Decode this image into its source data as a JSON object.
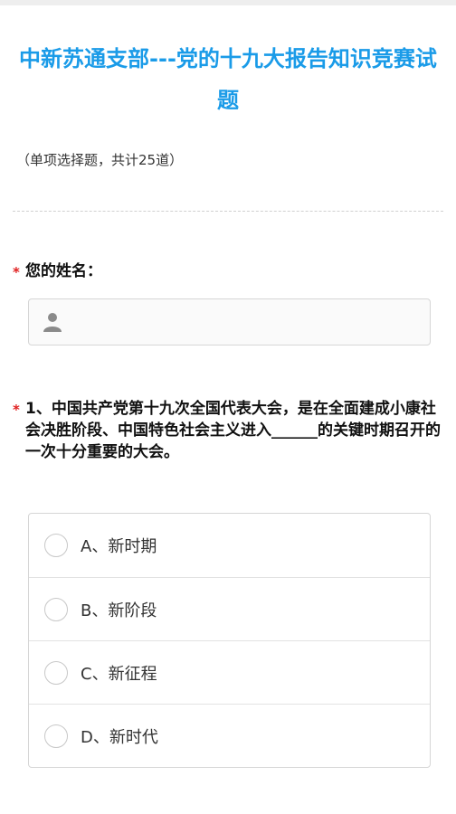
{
  "survey": {
    "title": "中新苏通支部---党的十九大报告知识竞赛试题",
    "description": "（单项选择题，共计25道）"
  },
  "questions": {
    "name": {
      "required_mark": "*",
      "label": "您的姓名：",
      "value": "",
      "icon": "person-icon"
    },
    "q1": {
      "required_mark": "*",
      "text": "1、中国共产党第十九次全国代表大会，是在全面建成小康社会决胜阶段、中国特色社会主义进入______的关键时期召开的一次十分重要的大会。",
      "options": [
        "A、新时期",
        "B、新阶段",
        "C、新征程",
        "D、新时代"
      ]
    }
  },
  "colors": {
    "title": "#1a9be8",
    "required": "#e02020",
    "border": "#d6d6d6"
  }
}
